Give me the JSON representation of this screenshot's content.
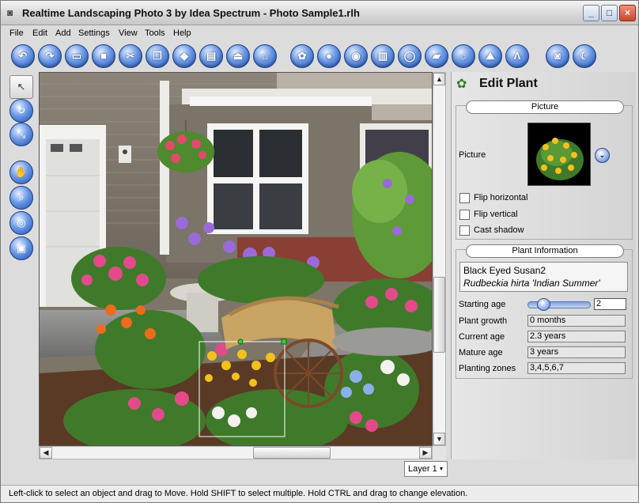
{
  "window": {
    "title": "Realtime Landscaping Photo 3 by Idea Spectrum - Photo Sample1.rlh",
    "app_icon": "camera-icon",
    "minimize_glyph": "_",
    "maximize_glyph": "□",
    "close_glyph": "×"
  },
  "menu": [
    "File",
    "Edit",
    "Add",
    "Settings",
    "View",
    "Tools",
    "Help"
  ],
  "toolbar": {
    "buttons": [
      {
        "icon": "undo-icon",
        "glyph": "↶"
      },
      {
        "icon": "redo-icon",
        "glyph": "↷"
      },
      {
        "icon": "open-folder-icon",
        "glyph": "▭"
      },
      {
        "icon": "save-disk-icon",
        "glyph": "■"
      },
      {
        "icon": "cut-scissors-icon",
        "glyph": "✂"
      },
      {
        "icon": "copy-icon",
        "glyph": "❐"
      },
      {
        "icon": "paste-icon",
        "glyph": "◆"
      },
      {
        "icon": "print-icon",
        "glyph": "▤"
      },
      {
        "icon": "terrain-icon",
        "glyph": "⏏"
      },
      {
        "icon": "gazebo-icon",
        "glyph": "⌂"
      },
      {
        "icon": "add-plant-icon",
        "glyph": "✿"
      },
      {
        "icon": "add-shrub-icon",
        "glyph": "●"
      },
      {
        "icon": "add-rock-icon",
        "glyph": "◉"
      },
      {
        "icon": "add-fence-icon",
        "glyph": "▥"
      },
      {
        "icon": "add-mulch-region-icon",
        "glyph": "◯"
      },
      {
        "icon": "add-wall-icon",
        "glyph": "▰"
      },
      {
        "icon": "add-light-icon",
        "glyph": "☼"
      },
      {
        "icon": "add-edging-icon",
        "glyph": "⛰"
      },
      {
        "icon": "add-text-icon",
        "glyph": "Λ"
      },
      {
        "icon": "camera-icon",
        "glyph": "◙"
      },
      {
        "icon": "night-mode-icon",
        "glyph": "☾"
      }
    ]
  },
  "left_tools": [
    {
      "icon": "select-arrow-icon",
      "glyph": "↖",
      "selected": true
    },
    {
      "icon": "rotate-icon",
      "glyph": "↻",
      "selected": false
    },
    {
      "icon": "resize-icon",
      "glyph": "⤡",
      "selected": false
    },
    {
      "icon": "pan-hand-icon",
      "glyph": "✋",
      "selected": false
    },
    {
      "icon": "zoom-icon",
      "glyph": "⌕",
      "selected": false
    },
    {
      "icon": "zoom-fit-icon",
      "glyph": "◎",
      "selected": false
    },
    {
      "icon": "fullscreen-icon",
      "glyph": "▣",
      "selected": false
    }
  ],
  "scroll": {
    "up": "▲",
    "down": "▼",
    "left": "◀",
    "right": "▶",
    "grip": "≡",
    "hgrip": "|||"
  },
  "layer": {
    "value": "Layer 1",
    "arrow": "▾"
  },
  "panel": {
    "title": "Edit Plant",
    "icon": "plant-icon",
    "picture_section": "Picture",
    "picture_label": "Picture",
    "picker_glyph": "⌄",
    "flip_horizontal": "Flip horizontal",
    "flip_vertical": "Flip vertical",
    "cast_shadow": "Cast shadow",
    "info_section": "Plant Information",
    "common_name": "Black Eyed Susan2",
    "scientific_name": "Rudbeckia hirta 'Indian Summer'",
    "starting_age_label": "Starting age",
    "starting_age_value": "2",
    "plant_growth_label": "Plant growth",
    "plant_growth_value": "0 months",
    "current_age_label": "Current age",
    "current_age_value": "2.3 years",
    "mature_age_label": "Mature age",
    "mature_age_value": "3 years",
    "planting_zones_label": "Planting zones",
    "planting_zones_value": "3,4,5,6,7"
  },
  "status": "Left-click to select an object and drag to Move. Hold SHIFT to select multiple. Hold CTRL and drag to change elevation."
}
